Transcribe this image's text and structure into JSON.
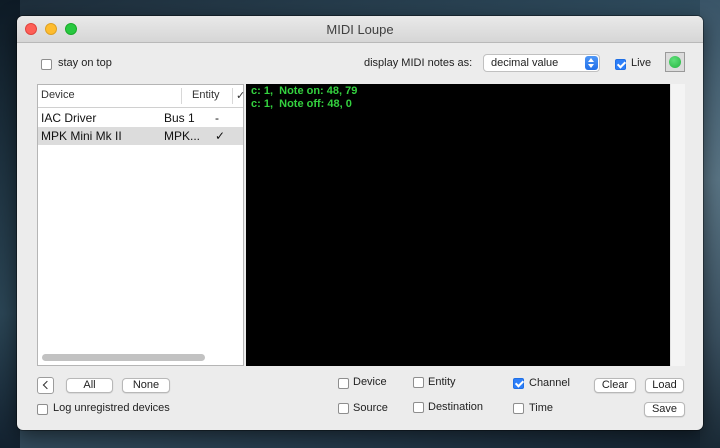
{
  "window": {
    "title": "MIDI Loupe"
  },
  "top_bar": {
    "stay_on_top": {
      "label": "stay on top",
      "checked": false
    },
    "display_label": "display MIDI notes as:",
    "display_select": {
      "value": "decimal value"
    },
    "live": {
      "label": "Live",
      "checked": true
    },
    "indicator_color": "#28c840"
  },
  "device_table": {
    "columns": [
      "Device",
      "Entity",
      "✓"
    ],
    "rows": [
      {
        "device": "IAC Driver",
        "entity": "Bus 1",
        "mark": "-",
        "selected": false
      },
      {
        "device": "MPK Mini Mk II",
        "entity": "MPK...",
        "mark": "✓",
        "selected": true
      }
    ]
  },
  "log": {
    "text_color": "#34d13f",
    "lines": [
      "c: 1,  Note on: 48, 79",
      "c: 1,  Note off: 48, 0"
    ]
  },
  "bottom": {
    "all_button": "All",
    "none_button": "None",
    "log_unregistered": {
      "label": "Log unregistred devices",
      "checked": false
    },
    "filters": {
      "device": {
        "label": "Device",
        "checked": false
      },
      "entity": {
        "label": "Entity",
        "checked": false
      },
      "channel": {
        "label": "Channel",
        "checked": true
      },
      "source": {
        "label": "Source",
        "checked": false
      },
      "destination": {
        "label": "Destination",
        "checked": false
      },
      "time": {
        "label": "Time",
        "checked": false
      }
    },
    "clear_button": "Clear",
    "load_button": "Load",
    "save_button": "Save"
  }
}
